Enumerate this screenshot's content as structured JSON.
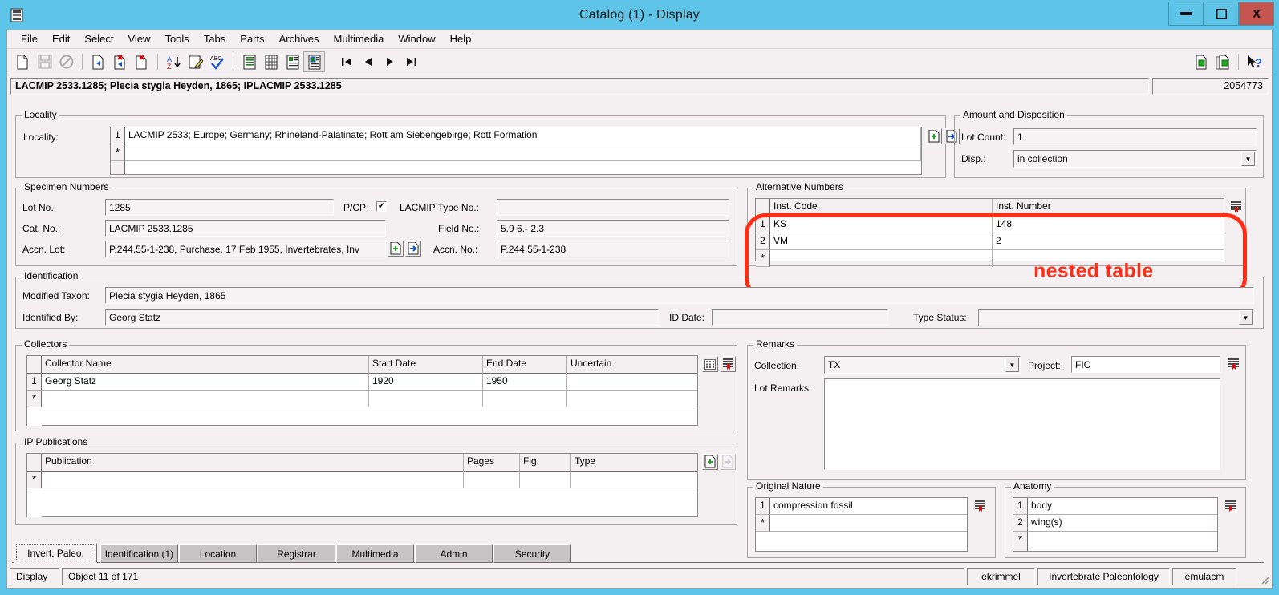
{
  "window": {
    "title": "Catalog (1) - Display",
    "minimize_label": "—",
    "maximize_label": "□",
    "close_label": "X"
  },
  "menu": [
    "File",
    "Edit",
    "Select",
    "View",
    "Tools",
    "Tabs",
    "Parts",
    "Archives",
    "Multimedia",
    "Window",
    "Help"
  ],
  "toolbar": {
    "icons": [
      "new-document-icon",
      "save-icon",
      "cancel-icon",
      "record-first-icon",
      "record-delete-icon",
      "record-new-icon",
      "sort-az-icon",
      "edit-note-icon",
      "spellcheck-icon",
      "list-view-icon",
      "grid-view-icon",
      "record-view-icon",
      "display-view-icon",
      "nav-first-icon",
      "nav-previous-icon",
      "nav-next-icon",
      "nav-last-icon"
    ],
    "right_icons": [
      "copy-record-icon",
      "paste-record-icon",
      "help-pointer-icon"
    ]
  },
  "record_header": {
    "title": "LACMIP 2533.1285; Plecia stygia Heyden, 1865; IPLACMIP 2533.1285",
    "record_id": "2054773"
  },
  "locality": {
    "group_label": "Locality",
    "field_label": "Locality:",
    "rows": [
      {
        "num": "1",
        "value": "LACMIP 2533; Europe; Germany; Rhineland-Palatinate; Rott am Siebengebirge; Rott Formation"
      },
      {
        "num": "*",
        "value": ""
      }
    ],
    "add_icon": "add-record-icon",
    "goto_icon": "goto-record-icon"
  },
  "amount_disposition": {
    "group_label": "Amount and Disposition",
    "lot_count_label": "Lot Count:",
    "lot_count_value": "1",
    "disposition_label": "Disp.:",
    "disposition_value": "in collection",
    "disposition_options": [
      "in collection"
    ]
  },
  "specimen_numbers": {
    "group_label": "Specimen Numbers",
    "lot_no_label": "Lot No.:",
    "lot_no_value": "1285",
    "pcp_label": "P/CP:",
    "pcp_checked": "✔",
    "cat_no_label": "Cat. No.:",
    "cat_no_value": "LACMIP 2533.1285",
    "accn_lot_label": "Accn. Lot:",
    "accn_lot_value": "P.244.55-1-238, Purchase, 17 Feb 1955, Invertebrates, Inv",
    "lacmip_type_no_label": "LACMIP Type No.:",
    "lacmip_type_no_value": "",
    "field_no_label": "Field No.:",
    "field_no_value": "5.9 6.- 2.3",
    "accn_no_label": "Accn. No.:",
    "accn_no_value": "P.244.55-1-238",
    "add_icon": "add-record-icon",
    "goto_icon": "goto-record-icon"
  },
  "alternative_numbers": {
    "group_label": "Alternative Numbers",
    "columns": [
      "Inst. Code",
      "Inst. Number"
    ],
    "rows": [
      {
        "num": "1",
        "code": "KS",
        "number": "148"
      },
      {
        "num": "2",
        "code": "VM",
        "number": "2"
      },
      {
        "num": "*",
        "code": "",
        "number": ""
      }
    ],
    "attribute_icon": "attributes-icon"
  },
  "identification": {
    "group_label": "Identification",
    "modified_taxon_label": "Modified Taxon:",
    "modified_taxon_value": "Plecia stygia Heyden, 1865",
    "identified_by_label": "Identified By:",
    "identified_by_value": "Georg Statz",
    "id_date_label": "ID Date:",
    "id_date_value": "",
    "type_status_label": "Type Status:",
    "type_status_value": "",
    "type_status_options": []
  },
  "collectors": {
    "group_label": "Collectors",
    "columns": [
      "Collector Name",
      "Start Date",
      "End Date",
      "Uncertain"
    ],
    "rows": [
      {
        "num": "1",
        "name": "Georg Statz",
        "start": "1920",
        "end": "1950",
        "uncertain": ""
      },
      {
        "num": "*",
        "name": "",
        "start": "",
        "end": "",
        "uncertain": ""
      }
    ],
    "grid_icon": "grid-icon",
    "attribute_icon": "attributes-icon"
  },
  "remarks": {
    "group_label": "Remarks",
    "collection_label": "Collection:",
    "collection_value": "TX",
    "collection_options": [
      "TX"
    ],
    "project_label": "Project:",
    "project_value": "FIC",
    "lot_remarks_label": "Lot Remarks:",
    "lot_remarks_value": "",
    "attribute_icon": "attributes-icon"
  },
  "ip_publications": {
    "group_label": "IP Publications",
    "columns": [
      "Publication",
      "Pages",
      "Fig.",
      "Type"
    ],
    "rows": [
      {
        "num": "*",
        "publication": "",
        "pages": "",
        "fig": "",
        "type": ""
      }
    ],
    "add_icon": "add-record-icon",
    "goto_icon": "goto-record-icon"
  },
  "original_nature": {
    "group_label": "Original Nature",
    "rows": [
      {
        "num": "1",
        "value": "compression fossil"
      },
      {
        "num": "*",
        "value": ""
      }
    ],
    "attribute_icon": "attributes-icon"
  },
  "anatomy": {
    "group_label": "Anatomy",
    "rows": [
      {
        "num": "1",
        "value": "body"
      },
      {
        "num": "2",
        "value": "wing(s)"
      },
      {
        "num": "*",
        "value": ""
      }
    ],
    "attribute_icon": "attributes-icon"
  },
  "tabs": [
    {
      "label": "Invert. Paleo.",
      "active": true
    },
    {
      "label": "Identification (1)",
      "active": false
    },
    {
      "label": "Location",
      "active": false
    },
    {
      "label": "Registrar",
      "active": false
    },
    {
      "label": "Multimedia",
      "active": false
    },
    {
      "label": "Admin",
      "active": false
    },
    {
      "label": "Security",
      "active": false
    }
  ],
  "statusbar": {
    "mode": "Display",
    "record_position": "Object 11 of 171",
    "user": "ekrimmel",
    "department": "Invertebrate Paleontology",
    "server": "emulacm"
  },
  "annotation": {
    "text": "nested table",
    "color": "#ff2d16"
  }
}
